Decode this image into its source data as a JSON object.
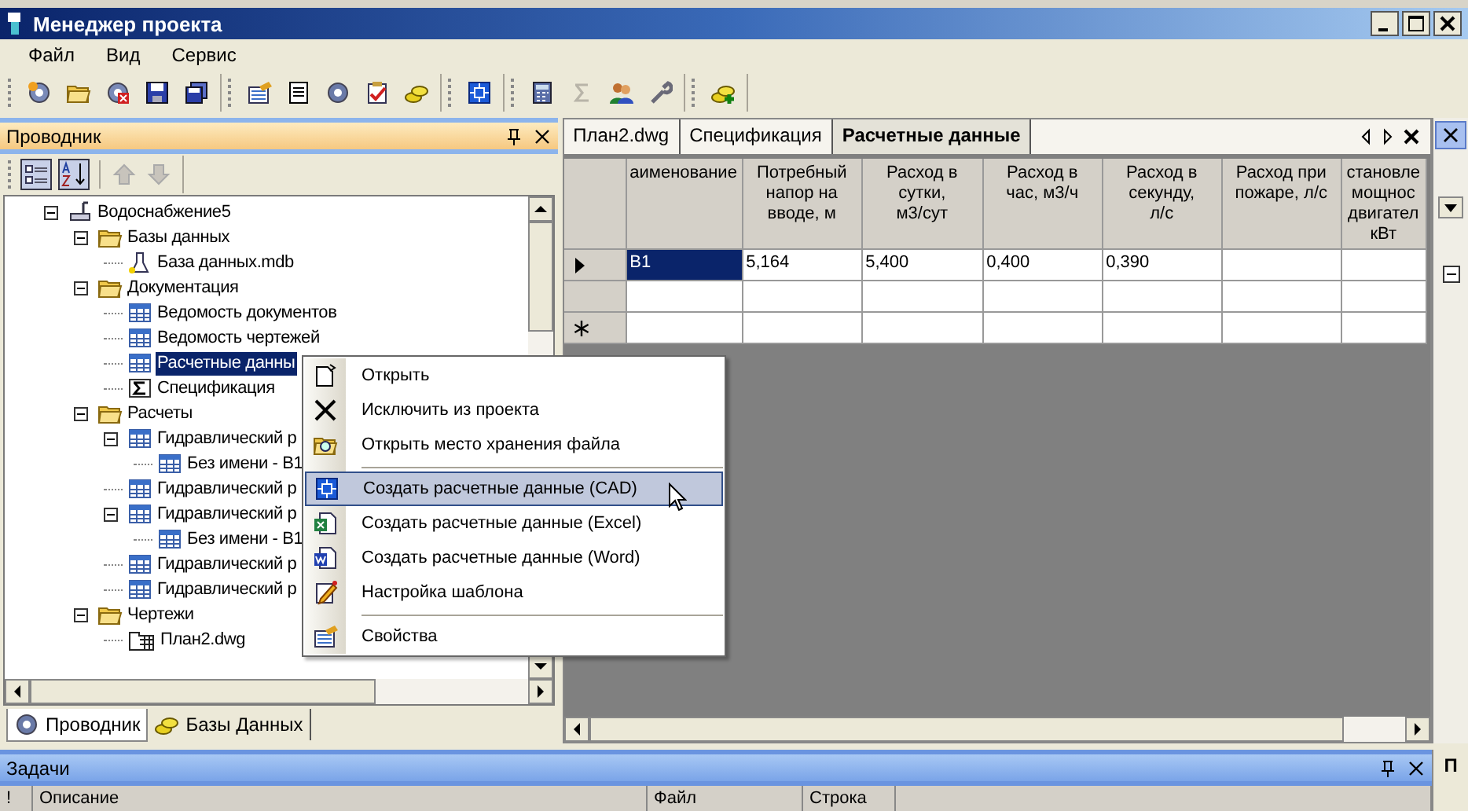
{
  "window": {
    "title": "Менеджер проекта"
  },
  "menu": [
    "Файл",
    "Вид",
    "Сервис"
  ],
  "explorer": {
    "title": "Проводник",
    "tree": [
      {
        "label": "Водоснабжение5",
        "kind": "project",
        "expanded": true,
        "selected": false,
        "children": [
          {
            "label": "Базы данных",
            "kind": "folder",
            "expanded": true,
            "selected": false,
            "children": [
              {
                "label": "База данных.mdb",
                "kind": "database",
                "selected": false
              }
            ]
          },
          {
            "label": "Документация",
            "kind": "folder",
            "expanded": true,
            "selected": false,
            "children": [
              {
                "label": "Ведомость документов",
                "kind": "table",
                "selected": false
              },
              {
                "label": "Ведомость чертежей",
                "kind": "table",
                "selected": false
              },
              {
                "label": "Расчетные данны",
                "kind": "table",
                "selected": true
              },
              {
                "label": "Спецификация",
                "kind": "sum",
                "selected": false
              }
            ]
          },
          {
            "label": "Расчеты",
            "kind": "folder",
            "expanded": true,
            "selected": false,
            "children": [
              {
                "label": "Гидравлический р",
                "kind": "table",
                "expanded": true,
                "selected": false,
                "children": [
                  {
                    "label": "Без имени - В1",
                    "kind": "table",
                    "selected": false
                  }
                ]
              },
              {
                "label": "Гидравлический р",
                "kind": "table",
                "selected": false
              },
              {
                "label": "Гидравлический р",
                "kind": "table",
                "expanded": true,
                "selected": false,
                "children": [
                  {
                    "label": "Без имени - В1",
                    "kind": "table",
                    "selected": false
                  }
                ]
              },
              {
                "label": "Гидравлический р",
                "kind": "table",
                "selected": false
              },
              {
                "label": "Гидравлический р",
                "kind": "table",
                "selected": false
              }
            ]
          },
          {
            "label": "Чертежи",
            "kind": "folder",
            "expanded": true,
            "selected": false,
            "children": [
              {
                "label": "План2.dwg",
                "kind": "drawing",
                "selected": false
              }
            ]
          }
        ]
      }
    ],
    "tabs": [
      {
        "label": "Проводник",
        "selected": true
      },
      {
        "label": "Базы Данных",
        "selected": false
      }
    ]
  },
  "documents": {
    "tabs": [
      {
        "label": "План2.dwg",
        "selected": false
      },
      {
        "label": "Спецификация",
        "selected": false
      },
      {
        "label": "Расчетные данные",
        "selected": true
      }
    ],
    "grid": {
      "columns": [
        "аименование",
        "Потребный\nнапор на\nвводе, м",
        "Расход в\nсутки,\nм3/сут",
        "Расход в\nчас, м3/ч",
        "Расход в\nсекунду,\nл/с",
        "Расход при\nпожаре, л/с",
        "становле\nмощнос\nдвигател\nкВт"
      ],
      "rows": [
        {
          "kind": "current",
          "cells": [
            {
              "text": "В1",
              "selected": true
            },
            {
              "text": "5,164",
              "selected": false
            },
            {
              "text": "5,400",
              "selected": false
            },
            {
              "text": "0,400",
              "selected": false
            },
            {
              "text": "0,390",
              "selected": false
            }
          ]
        },
        {
          "kind": "plain"
        },
        {
          "kind": "new"
        }
      ]
    }
  },
  "context_menu": {
    "items": [
      {
        "kind": "item",
        "label": "Открыть",
        "selected": false
      },
      {
        "kind": "item",
        "label": "Исключить из проекта",
        "selected": false
      },
      {
        "kind": "item",
        "label": "Открыть место хранения файла",
        "selected": false
      },
      {
        "kind": "separator"
      },
      {
        "kind": "item",
        "label": "Создать расчетные данные (CAD)",
        "selected": true
      },
      {
        "kind": "item",
        "label": "Создать расчетные данные (Excel)",
        "selected": false
      },
      {
        "kind": "item",
        "label": "Создать расчетные данные (Word)",
        "selected": false
      },
      {
        "kind": "item",
        "label": "Настройка шаблона",
        "selected": false
      },
      {
        "kind": "separator"
      },
      {
        "kind": "item",
        "label": "Свойства",
        "selected": false
      }
    ]
  },
  "tasks": {
    "title": "Задачи",
    "columns": [
      "!",
      "Описание",
      "Файл",
      "Строка"
    ]
  },
  "side_panel": {
    "label": "П"
  }
}
